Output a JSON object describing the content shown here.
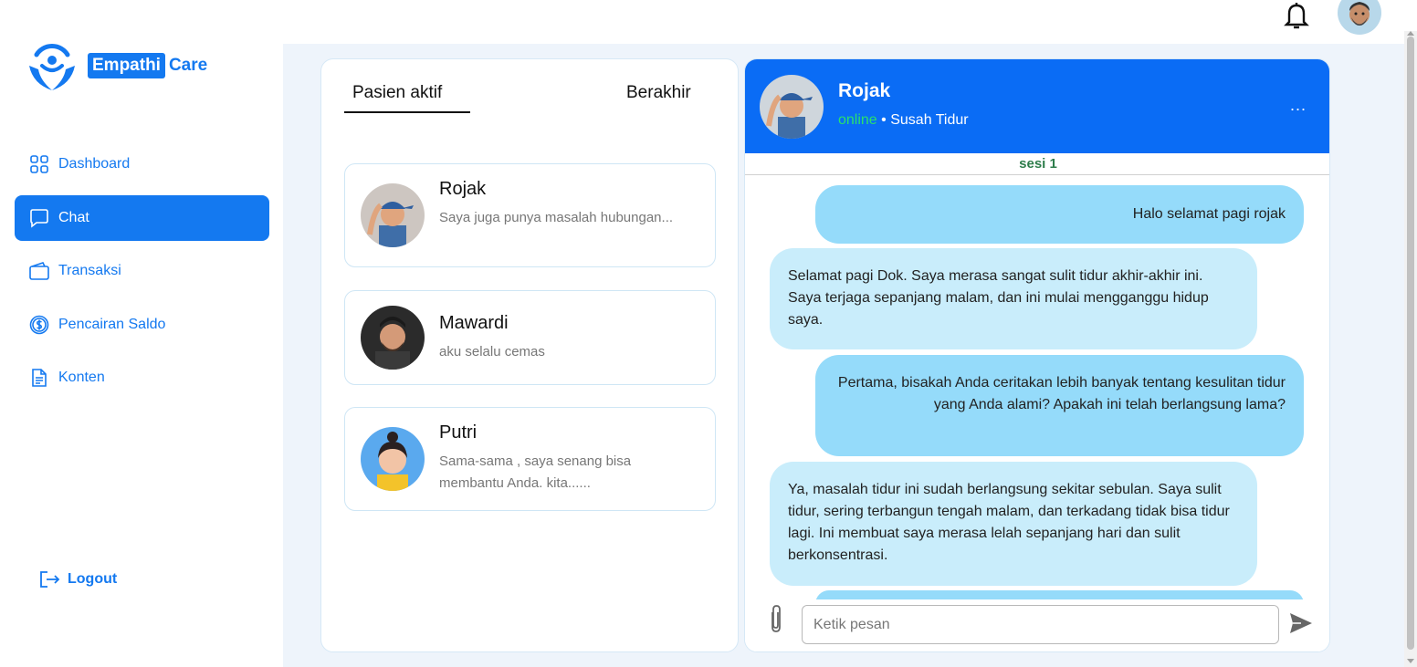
{
  "brand": {
    "part1": "Empathi",
    "part2": "Care",
    "accent": "#1479f0"
  },
  "sidebar": {
    "items": [
      {
        "label": "Dashboard",
        "icon": "grid-icon"
      },
      {
        "label": "Chat",
        "icon": "chat-icon",
        "active": true
      },
      {
        "label": "Transaksi",
        "icon": "wallet-icon"
      },
      {
        "label": "Pencairan Saldo",
        "icon": "dollar-circle-icon"
      },
      {
        "label": "Konten",
        "icon": "document-icon"
      }
    ],
    "logout_label": "Logout"
  },
  "patients": {
    "tabs": [
      "Pasien aktif",
      "Berakhir"
    ],
    "list": [
      {
        "name": "Rojak",
        "message": "Saya juga punya masalah hubungan..."
      },
      {
        "name": "Mawardi",
        "message": "aku selalu cemas"
      },
      {
        "name": "Putri",
        "message": "Sama-sama , saya senang bisa membantu Anda. kita......"
      }
    ]
  },
  "chat": {
    "name": "Rojak",
    "status": "online",
    "separator": "•",
    "topic": "Susah Tidur",
    "menu": "...",
    "session": "sesi 1",
    "messages": [
      {
        "from": "doctor",
        "text": "Halo selamat pagi rojak"
      },
      {
        "from": "patient",
        "text": "Selamat pagi Dok. Saya merasa sangat sulit tidur akhir-akhir ini. Saya terjaga sepanjang malam, dan ini mulai mengganggu hidup saya."
      },
      {
        "from": "doctor",
        "text": "Pertama, bisakah Anda ceritakan lebih banyak tentang kesulitan tidur yang Anda alami? Apakah ini telah berlangsung lama?"
      },
      {
        "from": "patient",
        "text": "Ya, masalah tidur ini sudah berlangsung sekitar sebulan. Saya sulit tidur, sering terbangun tengah malam, dan terkadang tidak bisa tidur lagi. Ini membuat saya merasa lelah sepanjang hari dan sulit berkonsentrasi."
      }
    ],
    "input_placeholder": "Ketik pesan"
  }
}
